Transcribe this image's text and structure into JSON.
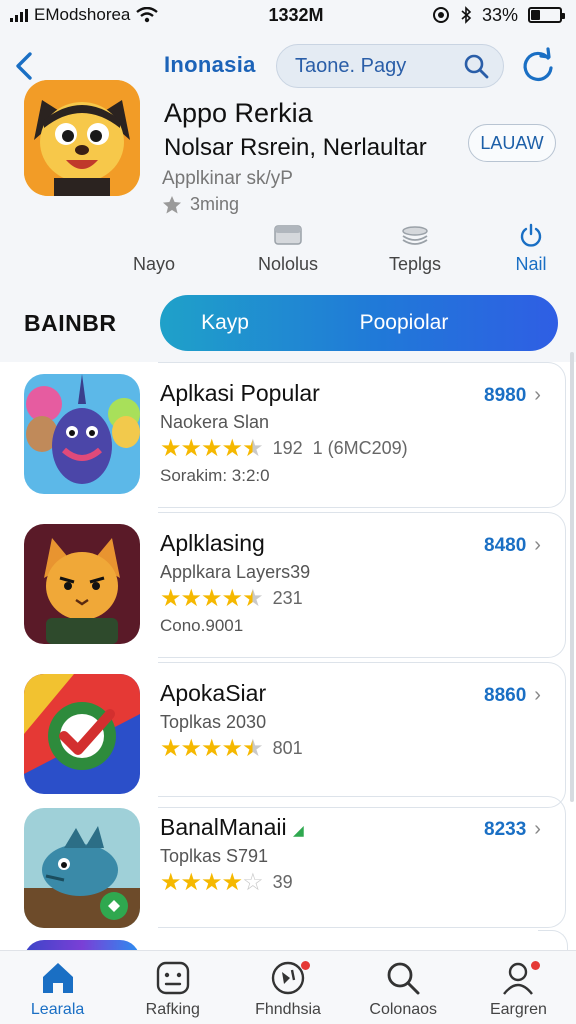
{
  "status_bar": {
    "carrier": "EModshorea",
    "time": "1332M",
    "battery": "33%",
    "battery_level": 0.33
  },
  "nav": {
    "title": "Inonasia",
    "search_placeholder": "Taone. Pagy"
  },
  "app": {
    "name": "Appo Rerkia",
    "subtitle": "Nolsar Rsrein, Nerlaultar",
    "category": "Applkinar sk/yP",
    "rating_text": "3ming",
    "launch_label": "LAUAW"
  },
  "actions": [
    {
      "label": "Nayo",
      "icon": "none"
    },
    {
      "label": "Nololus",
      "icon": "tray-icon"
    },
    {
      "label": "Teplgs",
      "icon": "stack-icon"
    },
    {
      "label": "Nail",
      "icon": "power-icon"
    }
  ],
  "section": {
    "label": "BAINBR",
    "segment_left": "Kayp",
    "segment_right": "Poopiolar"
  },
  "apps": [
    {
      "title": "Aplkasi Popular",
      "subtitle": "Naokera Slan",
      "stars": 4.5,
      "rating_count": "192",
      "extra_count": "1 (6MC209)",
      "extra": "Sorakim: 3:2:0",
      "price": "8980",
      "colors": [
        "#3b6fd1",
        "#7d3aa8",
        "#f2c94c"
      ]
    },
    {
      "title": "Aplklasing",
      "subtitle": "Applkara Layers39",
      "stars": 4.5,
      "rating_count": "231",
      "extra_count": "",
      "extra": "Cono.9001",
      "price": "8480",
      "colors": [
        "#6b1d2a",
        "#f0a030",
        "#2e5131"
      ]
    },
    {
      "title": "ApokaSiar",
      "subtitle": "Toplkas 2030",
      "stars": 4.5,
      "rating_count": "801",
      "extra_count": "",
      "extra": "",
      "price": "8860",
      "colors": [
        "#e53935",
        "#2e8b3c",
        "#2b4fc9"
      ]
    },
    {
      "title": "BanalManaii",
      "subtitle": "Toplkas S791",
      "stars": 4,
      "rating_count": "39",
      "extra_count": "",
      "extra": "",
      "price": "8233",
      "colors": [
        "#3a8aa8",
        "#6d4b2a",
        "#2fa84f"
      ]
    }
  ],
  "tabs": [
    {
      "label": "Learala",
      "icon": "home-icon",
      "active": true,
      "badge": false
    },
    {
      "label": "Rafking",
      "icon": "controller-icon",
      "active": false,
      "badge": false
    },
    {
      "label": "Fhndhsia",
      "icon": "explore-icon",
      "active": false,
      "badge": true
    },
    {
      "label": "Colonaos",
      "icon": "search-icon",
      "active": false,
      "badge": false
    },
    {
      "label": "Eargren",
      "icon": "profile-icon",
      "active": false,
      "badge": true
    }
  ],
  "colors": {
    "accent": "#1a6fc4",
    "star": "#f5b800",
    "segment_start": "#1fa1c9",
    "segment_end": "#2f5ee4"
  }
}
